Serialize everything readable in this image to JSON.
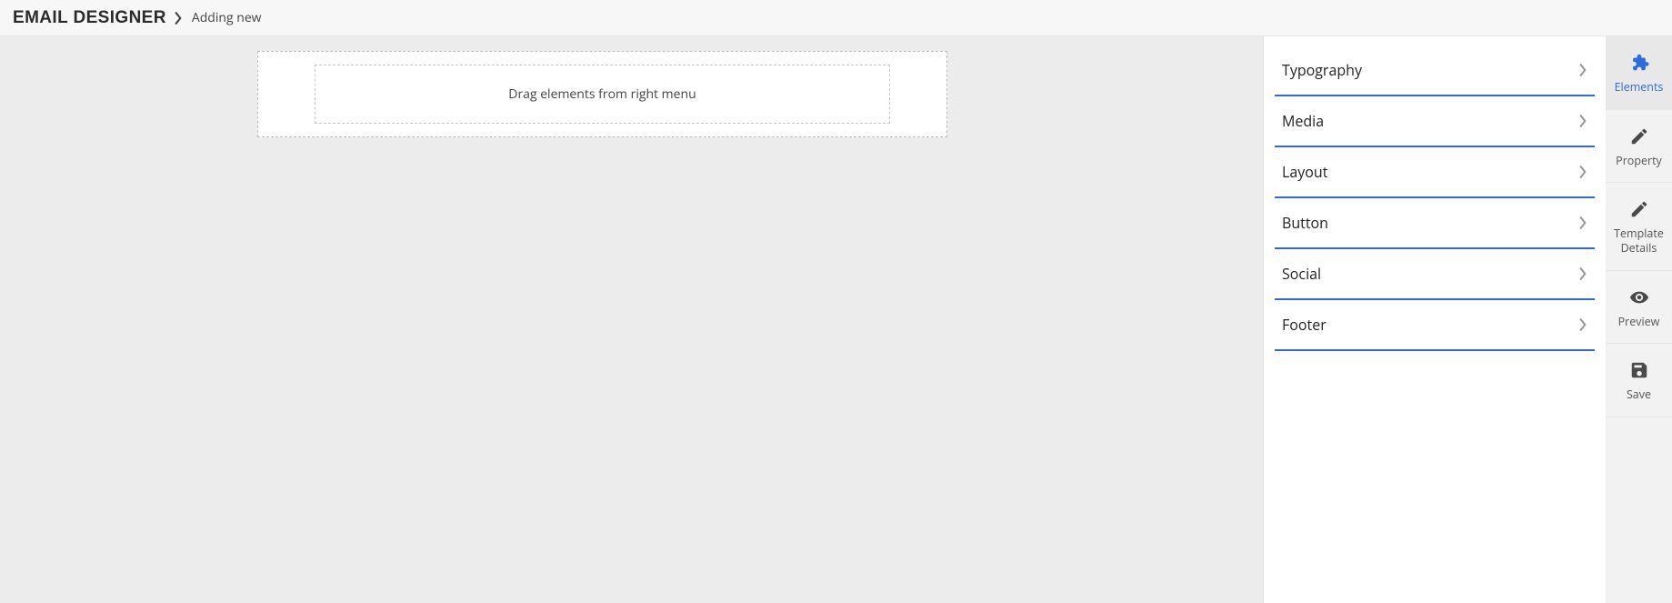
{
  "breadcrumb": {
    "title": "EMAIL DESIGNER",
    "current": "Adding new"
  },
  "canvas": {
    "placeholder": "Drag elements from right menu"
  },
  "elements_panel": {
    "items": [
      {
        "label": "Typography"
      },
      {
        "label": "Media"
      },
      {
        "label": "Layout"
      },
      {
        "label": "Button"
      },
      {
        "label": "Social"
      },
      {
        "label": "Footer"
      }
    ]
  },
  "rail": {
    "items": [
      {
        "label": "Elements",
        "icon": "puzzle-icon",
        "active": true
      },
      {
        "label": "Property",
        "icon": "pencil-icon",
        "active": false
      },
      {
        "label": "Template Details",
        "icon": "pencil-icon",
        "active": false
      },
      {
        "label": "Preview",
        "icon": "eye-icon",
        "active": false
      },
      {
        "label": "Save",
        "icon": "save-icon",
        "active": false
      }
    ]
  }
}
